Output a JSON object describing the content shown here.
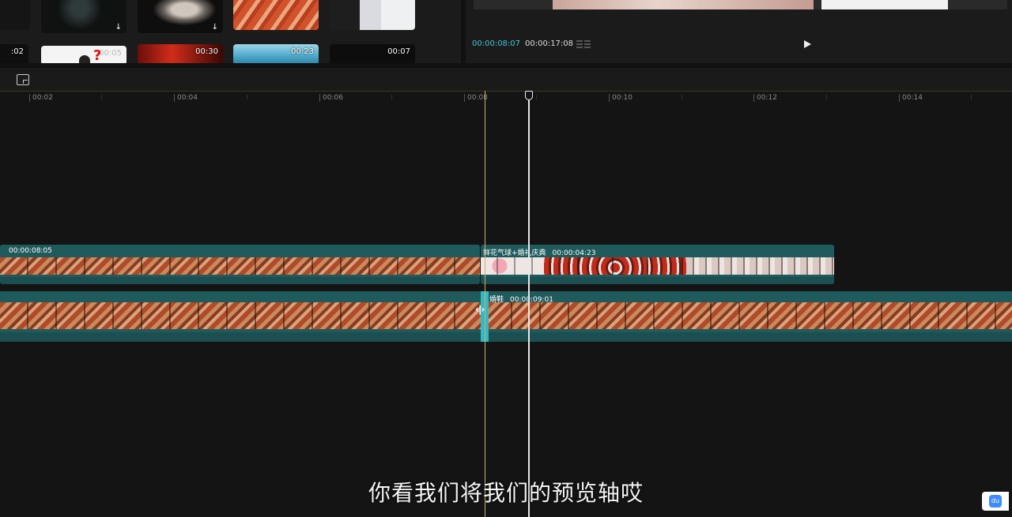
{
  "media_library": {
    "thumbnails": [
      {
        "duration": "",
        "has_download": false,
        "name": "clip-partial-left-top"
      },
      {
        "duration": "",
        "has_download": true,
        "name": "clip-dark-chandelier"
      },
      {
        "duration": "",
        "has_download": true,
        "name": "clip-smoke"
      },
      {
        "duration": "",
        "has_download": false,
        "name": "clip-red-shoes"
      },
      {
        "duration": "",
        "has_download": false,
        "name": "clip-couple"
      },
      {
        "duration": ":02",
        "has_download": false,
        "name": "clip-partial-left-bottom"
      },
      {
        "duration": "00:05",
        "has_download": false,
        "name": "clip-question"
      },
      {
        "duration": "00:30",
        "has_download": false,
        "name": "clip-red"
      },
      {
        "duration": "00:23",
        "has_download": false,
        "name": "clip-ocean"
      },
      {
        "duration": "00:07",
        "has_download": false,
        "name": "clip-black"
      }
    ],
    "download_icon": "↓"
  },
  "preview": {
    "current_time": "00:00:08:07",
    "total_time": "00:00:17:08",
    "play_icon": "play-icon"
  },
  "timeline": {
    "ruler_labels": [
      "00:02",
      "00:04",
      "00:06",
      "00:08",
      "00:10",
      "00:12",
      "00:14"
    ],
    "tracks": {
      "b_roll": [
        {
          "title": "",
          "duration": "00:00:08:05"
        },
        {
          "title": "鲜花气球+婚礼庆典",
          "duration": "00:00:04:23"
        }
      ],
      "main": [
        {
          "title": "婚鞋",
          "duration": "00:00:09:01"
        }
      ]
    }
  },
  "subtitle": "你看我们将我们的预览轴哎",
  "badge_label": "du"
}
